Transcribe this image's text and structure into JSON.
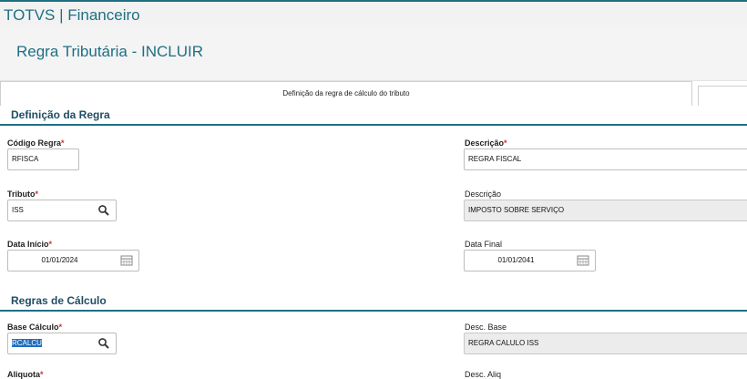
{
  "app": {
    "title": "TOTVS | Financeiro"
  },
  "page": {
    "title": "Regra Tributária - INCLUIR"
  },
  "tabs": [
    {
      "label": "Definição da regra de cálculo do tributo"
    },
    {
      "label": ""
    }
  ],
  "sections": {
    "definicao": "Definição da Regra",
    "calculo": "Regras de Cálculo"
  },
  "fields": {
    "codigo_regra": {
      "label": "Código Regra",
      "value": "RFISCA"
    },
    "descricao": {
      "label": "Descrição",
      "value": "REGRA FISCAL"
    },
    "tributo": {
      "label": "Tributo",
      "value": "ISS"
    },
    "descricao_tributo": {
      "label": "Descrição",
      "value": "IMPOSTO SOBRE SERVIÇO"
    },
    "data_inicio": {
      "label": "Data Início",
      "value": "01/01/2024"
    },
    "data_final": {
      "label": "Data Final",
      "value": "01/01/2041"
    },
    "base_calculo": {
      "label": "Base Cálculo",
      "value": "RCALCU"
    },
    "desc_base": {
      "label": "Desc. Base",
      "value": "REGRA CALULO ISS"
    },
    "aliquota": {
      "label": "Aliquota"
    },
    "desc_aliq": {
      "label": "Desc. Aliq"
    }
  },
  "required_mark": "*",
  "colors": {
    "accent": "#1f6f82",
    "required": "#d32f2f"
  }
}
